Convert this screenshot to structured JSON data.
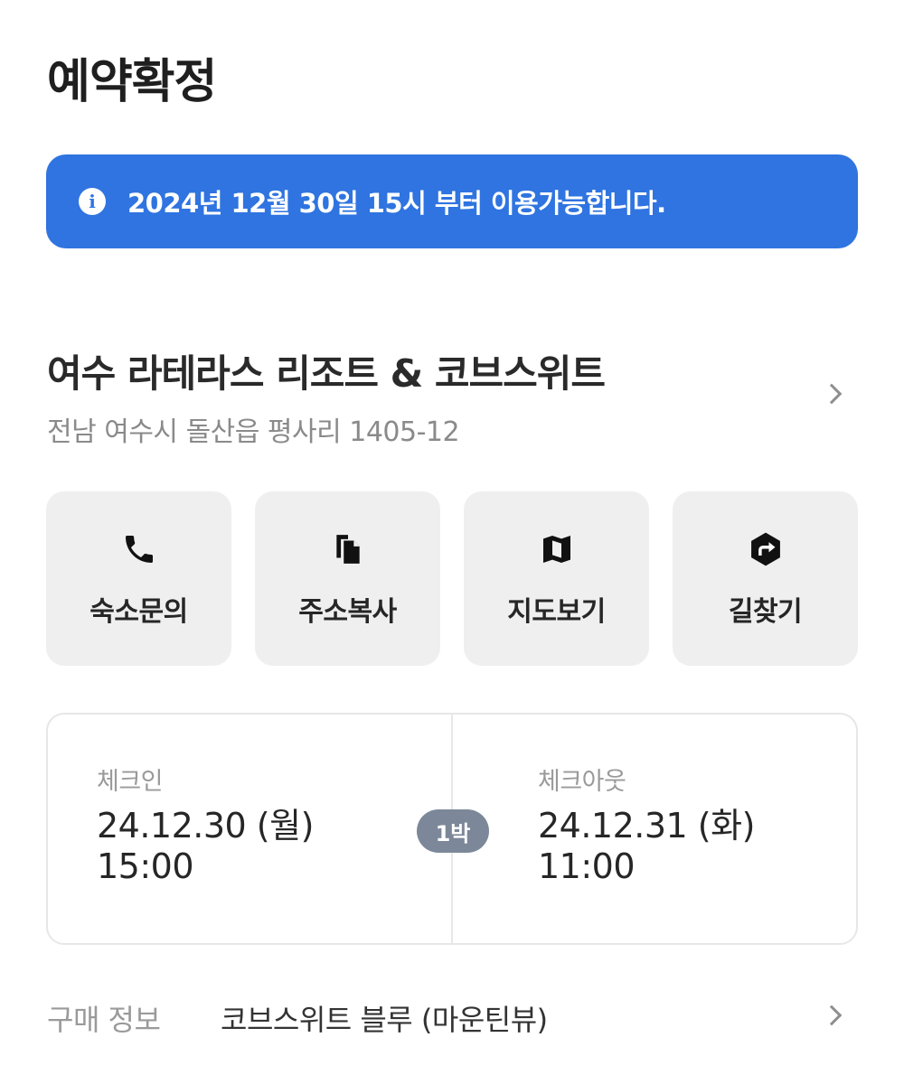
{
  "header": {
    "title": "예약확정"
  },
  "notice": {
    "icon": "info-icon",
    "text": "2024년 12월 30일 15시 부터 이용가능합니다.",
    "background": "#2f74e0"
  },
  "hotel": {
    "name": "여수 라테라스 리조트 & 코브스위트",
    "address": "전남 여수시 돌산읍 평사리 1405-12"
  },
  "actions": [
    {
      "icon": "phone-icon",
      "label": "숙소문의"
    },
    {
      "icon": "copy-icon",
      "label": "주소복사"
    },
    {
      "icon": "map-icon",
      "label": "지도보기"
    },
    {
      "icon": "directions-icon",
      "label": "길찾기"
    }
  ],
  "stay": {
    "checkin": {
      "label": "체크인",
      "date": "24.12.30 (월)",
      "time": "15:00"
    },
    "nights": "1박",
    "checkout": {
      "label": "체크아웃",
      "date": "24.12.31 (화)",
      "time": "11:00"
    }
  },
  "purchase": {
    "label": "구매 정보",
    "value": "코브스위트 블루 (마운틴뷰)"
  }
}
